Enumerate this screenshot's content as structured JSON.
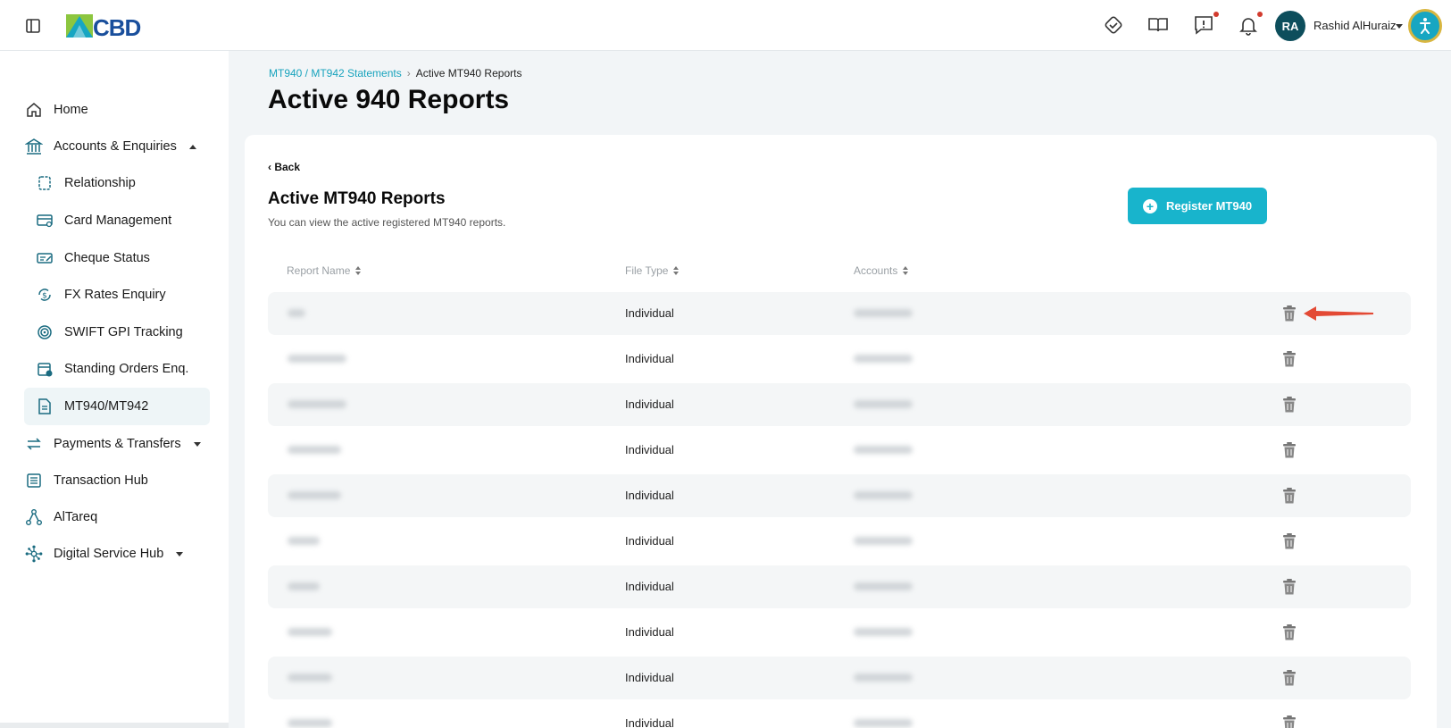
{
  "header": {
    "user_initials": "RA",
    "user_name": "Rashid AlHuraiz",
    "logo_text": "CBD",
    "brand_color": "#1a4f9c",
    "accent_color": "#18b4cc"
  },
  "sidebar": {
    "items": [
      {
        "label": "Home",
        "icon": "home-icon"
      },
      {
        "label": "Accounts & Enquiries",
        "icon": "bank-icon",
        "expanded": true
      },
      {
        "label": "Relationship",
        "icon": "relationship-icon",
        "sub": true
      },
      {
        "label": "Card Management",
        "icon": "card-icon",
        "sub": true
      },
      {
        "label": "Cheque Status",
        "icon": "cheque-icon",
        "sub": true
      },
      {
        "label": "FX Rates Enquiry",
        "icon": "fx-icon",
        "sub": true
      },
      {
        "label": "SWIFT GPI Tracking",
        "icon": "tracking-icon",
        "sub": true
      },
      {
        "label": "Standing Orders Enq.",
        "icon": "calendar-icon",
        "sub": true
      },
      {
        "label": "MT940/MT942",
        "icon": "document-icon",
        "sub": true,
        "active": true
      },
      {
        "label": "Payments & Transfers",
        "icon": "transfer-icon",
        "expanded": false
      },
      {
        "label": "Transaction Hub",
        "icon": "list-icon"
      },
      {
        "label": "AlTareq",
        "icon": "nodes-icon"
      },
      {
        "label": "Digital Service Hub",
        "icon": "hub-icon",
        "expanded": false
      }
    ]
  },
  "breadcrumb": {
    "parent": "MT940 / MT942 Statements",
    "separator": "›",
    "current": "Active MT940 Reports"
  },
  "page_title": "Active 940 Reports",
  "card": {
    "back_label": "‹ Back",
    "title": "Active MT940 Reports",
    "subtitle": "You can view the active registered MT940 reports.",
    "register_label": "Register MT940"
  },
  "table": {
    "columns": [
      "Report Name",
      "File Type",
      "Accounts"
    ],
    "rows": [
      {
        "file_type": "Individual"
      },
      {
        "file_type": "Individual"
      },
      {
        "file_type": "Individual"
      },
      {
        "file_type": "Individual"
      },
      {
        "file_type": "Individual"
      },
      {
        "file_type": "Individual"
      },
      {
        "file_type": "Individual"
      },
      {
        "file_type": "Individual"
      },
      {
        "file_type": "Individual"
      },
      {
        "file_type": "Individual"
      }
    ]
  },
  "annotation_color": "#e34a35"
}
